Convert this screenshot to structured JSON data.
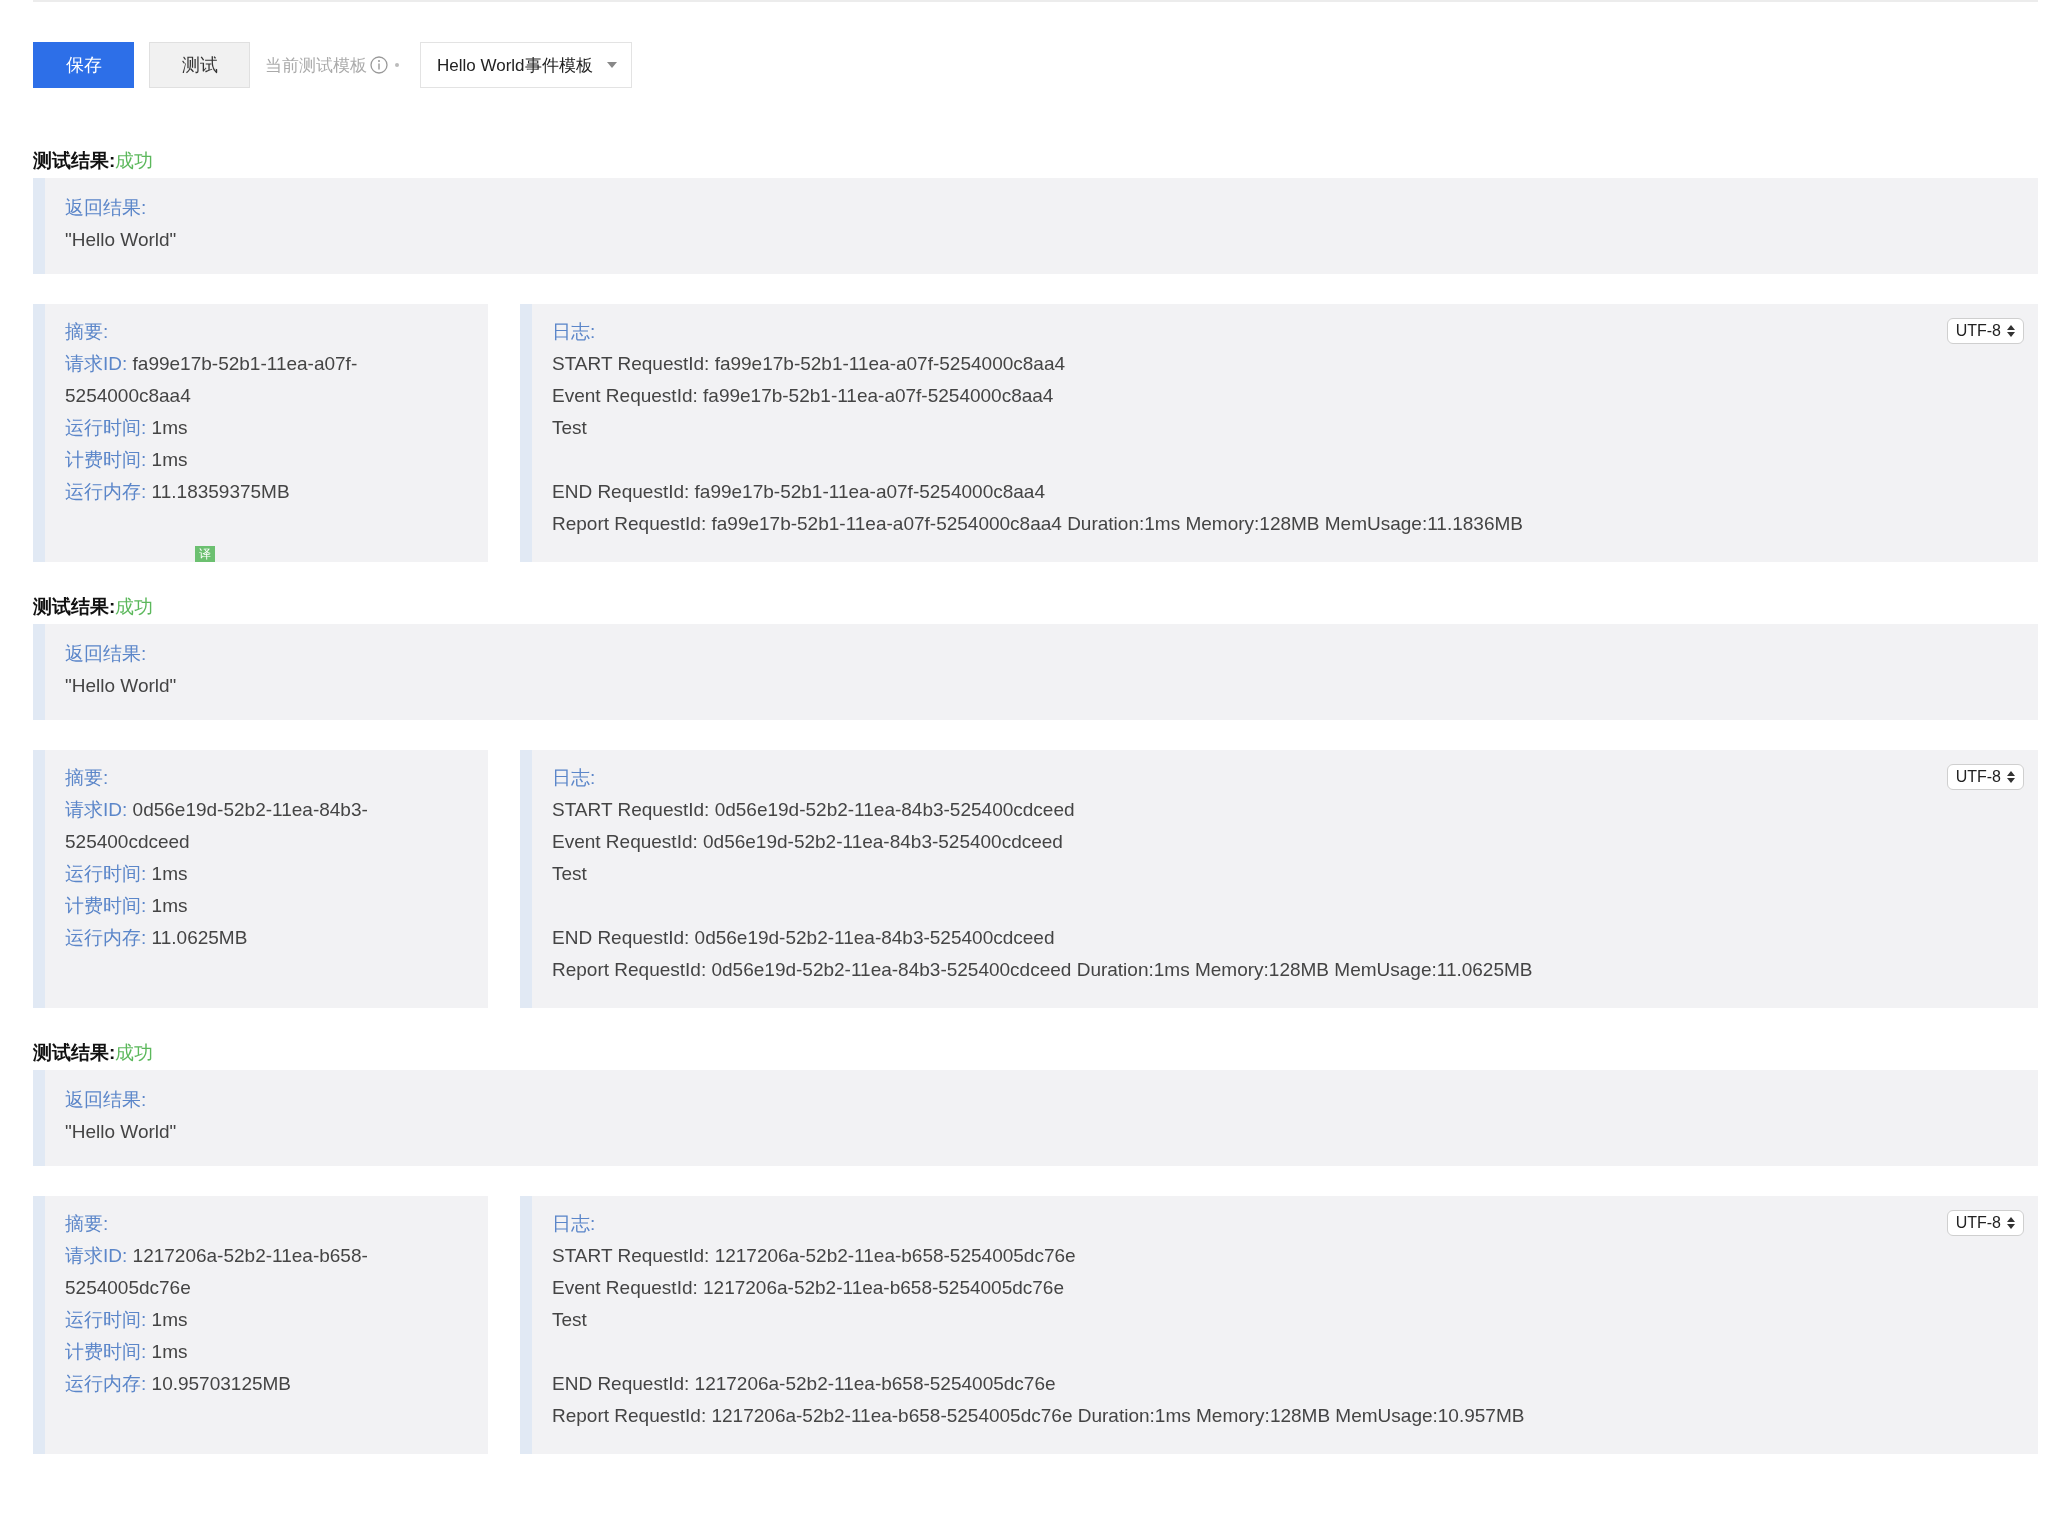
{
  "toolbar": {
    "save_button": "保存",
    "test_button": "测试",
    "template_label": "当前测试模板",
    "template_select": "Hello World事件模板"
  },
  "results": [
    {
      "heading": "测试结果:",
      "status": "成功",
      "return_label": "返回结果:",
      "return_value": "\"Hello World\"",
      "summary": {
        "title": "摘要:",
        "rows": [
          {
            "label": "请求ID:",
            "value": "fa99e17b-52b1-11ea-a07f-5254000c8aa4"
          },
          {
            "label": "运行时间:",
            "value": "1ms"
          },
          {
            "label": "计费时间:",
            "value": "1ms"
          },
          {
            "label": "运行内存:",
            "value": "11.18359375MB"
          }
        ],
        "badge": "译"
      },
      "log": {
        "title": "日志:",
        "encoding": "UTF-8",
        "blocks": [
          [
            "START RequestId: fa99e17b-52b1-11ea-a07f-5254000c8aa4",
            "Event RequestId: fa99e17b-52b1-11ea-a07f-5254000c8aa4",
            "Test"
          ],
          [
            "END RequestId: fa99e17b-52b1-11ea-a07f-5254000c8aa4",
            "Report RequestId: fa99e17b-52b1-11ea-a07f-5254000c8aa4 Duration:1ms Memory:128MB MemUsage:11.1836MB"
          ]
        ]
      }
    },
    {
      "heading": "测试结果:",
      "status": "成功",
      "return_label": "返回结果:",
      "return_value": "\"Hello World\"",
      "summary": {
        "title": "摘要:",
        "rows": [
          {
            "label": "请求ID:",
            "value": "0d56e19d-52b2-11ea-84b3-525400cdceed"
          },
          {
            "label": "运行时间:",
            "value": "1ms"
          },
          {
            "label": "计费时间:",
            "value": "1ms"
          },
          {
            "label": "运行内存:",
            "value": "11.0625MB"
          }
        ]
      },
      "log": {
        "title": "日志:",
        "encoding": "UTF-8",
        "blocks": [
          [
            "START RequestId: 0d56e19d-52b2-11ea-84b3-525400cdceed",
            "Event RequestId: 0d56e19d-52b2-11ea-84b3-525400cdceed",
            "Test"
          ],
          [
            "END RequestId: 0d56e19d-52b2-11ea-84b3-525400cdceed",
            "Report RequestId: 0d56e19d-52b2-11ea-84b3-525400cdceed Duration:1ms Memory:128MB MemUsage:11.0625MB"
          ]
        ]
      }
    },
    {
      "heading": "测试结果:",
      "status": "成功",
      "return_label": "返回结果:",
      "return_value": "\"Hello World\"",
      "summary": {
        "title": "摘要:",
        "rows": [
          {
            "label": "请求ID:",
            "value": "1217206a-52b2-11ea-b658-5254005dc76e"
          },
          {
            "label": "运行时间:",
            "value": "1ms"
          },
          {
            "label": "计费时间:",
            "value": "1ms"
          },
          {
            "label": "运行内存:",
            "value": "10.95703125MB"
          }
        ]
      },
      "log": {
        "title": "日志:",
        "encoding": "UTF-8",
        "blocks": [
          [
            "START RequestId: 1217206a-52b2-11ea-b658-5254005dc76e",
            "Event RequestId: 1217206a-52b2-11ea-b658-5254005dc76e",
            "Test"
          ],
          [
            "END RequestId: 1217206a-52b2-11ea-b658-5254005dc76e",
            "Report RequestId: 1217206a-52b2-11ea-b658-5254005dc76e Duration:1ms Memory:128MB MemUsage:10.957MB"
          ]
        ]
      }
    }
  ]
}
